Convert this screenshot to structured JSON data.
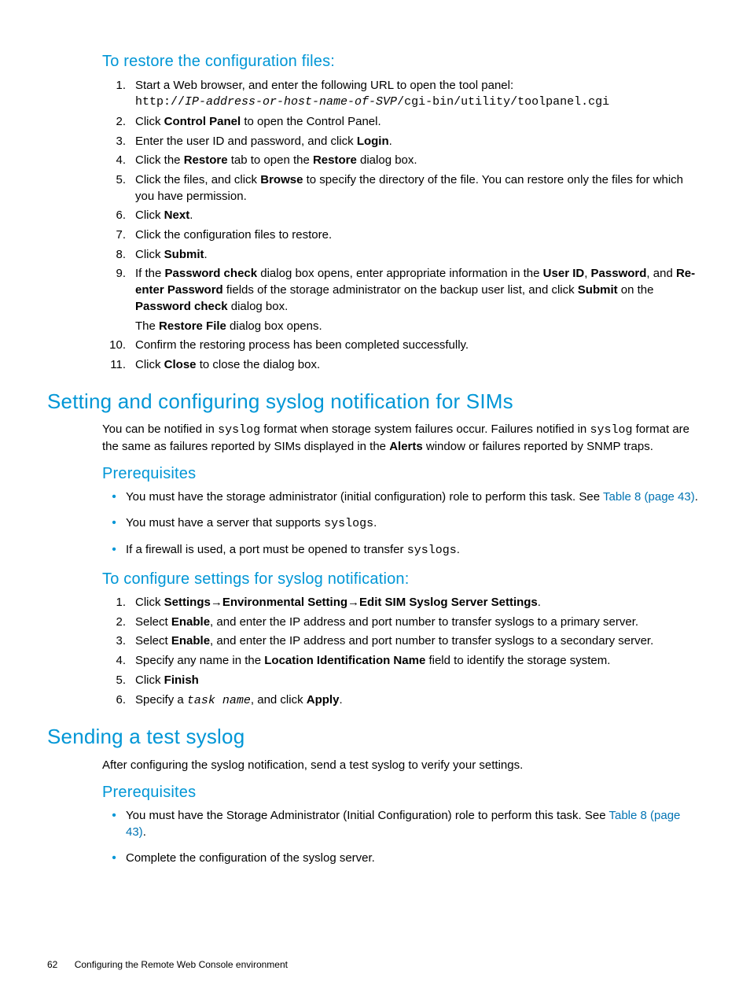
{
  "h_restore": "To restore the configuration files:",
  "restore_steps": {
    "s1a": "Start a Web browser, and enter the following URL to open the tool panel:",
    "s1b_pre": "http://",
    "s1b_ital": "IP-address-or-host-name-of-SVP",
    "s1b_post": "/cgi-bin/utility/toolpanel.cgi",
    "s2a": "Click ",
    "s2b": "Control Panel",
    "s2c": " to open the Control Panel.",
    "s3a": "Enter the user ID and password, and click ",
    "s3b": "Login",
    "s3c": ".",
    "s4a": "Click the ",
    "s4b": "Restore",
    "s4c": " tab to open the ",
    "s4d": "Restore",
    "s4e": " dialog box.",
    "s5a": "Click the files, and click ",
    "s5b": "Browse",
    "s5c": " to specify the directory of the file. You can restore only the files for which you have permission.",
    "s6a": "Click ",
    "s6b": "Next",
    "s6c": ".",
    "s7": "Click the configuration files to restore.",
    "s8a": "Click ",
    "s8b": "Submit",
    "s8c": ".",
    "s9a": "If the ",
    "s9b": "Password check",
    "s9c": " dialog box opens, enter appropriate information in the ",
    "s9d": "User ID",
    "s9e": ", ",
    "s9f": "Password",
    "s9g": ", and ",
    "s9h": "Re-enter Password",
    "s9i": " fields of the storage administrator on the backup user list, and click ",
    "s9j": "Submit",
    "s9k": " on the ",
    "s9l": "Password check",
    "s9m": " dialog box.",
    "s9n_a": "The ",
    "s9n_b": "Restore File",
    "s9n_c": " dialog box opens.",
    "s10": "Confirm the restoring process has been completed successfully.",
    "s11a": "Click ",
    "s11b": "Close",
    "s11c": " to close the dialog box."
  },
  "h_syslog": "Setting and configuring syslog notification for SIMs",
  "syslog_intro": {
    "a": "You can be notified in ",
    "b": "syslog",
    "c": " format when storage system failures occur. Failures notified in ",
    "d": "syslog",
    "e": " format are the same as failures reported by SIMs displayed in the ",
    "f": "Alerts",
    "g": " window or failures reported by SNMP traps."
  },
  "h_prereq1": "Prerequisites",
  "prereq1": {
    "b1a": "You must have the storage administrator (initial configuration) role to perform this task. See ",
    "b1b": "Table 8 (page 43)",
    "b1c": ".",
    "b2a": "You must have a server that supports ",
    "b2b": "syslogs",
    "b2c": ".",
    "b3a": "If a firewall is used, a port must be opened to transfer ",
    "b3b": "syslogs",
    "b3c": "."
  },
  "h_configure": "To configure settings for syslog notification:",
  "conf_steps": {
    "s1a": "Click ",
    "s1b": "Settings",
    "s1c": "→",
    "s1d": "Environmental Setting",
    "s1e": "→",
    "s1f": "Edit SIM Syslog Server Settings",
    "s1g": ".",
    "s2a": "Select ",
    "s2b": "Enable",
    "s2c": ", and enter the IP address and port number to transfer syslogs to a primary server.",
    "s3a": "Select ",
    "s3b": "Enable",
    "s3c": ", and enter the IP address and port number to transfer syslogs to a secondary server.",
    "s4a": "Specify any name in the ",
    "s4b": "Location Identification Name",
    "s4c": " field to identify the storage system.",
    "s5a": "Click ",
    "s5b": "Finish",
    "s6a": "Specify a ",
    "s6b": "task name",
    "s6c": ", and click ",
    "s6d": "Apply",
    "s6e": "."
  },
  "h_test": "Sending a test syslog",
  "test_intro": "After configuring the syslog notification, send a test syslog to verify your settings.",
  "h_prereq2": "Prerequisites",
  "prereq2": {
    "b1a": "You must have the Storage Administrator (Initial Configuration) role to perform this task. See ",
    "b1b": "Table 8 (page 43)",
    "b1c": ".",
    "b2": "Complete the configuration of the syslog server."
  },
  "footer": {
    "page": "62",
    "title": "Configuring the Remote Web Console environment"
  }
}
